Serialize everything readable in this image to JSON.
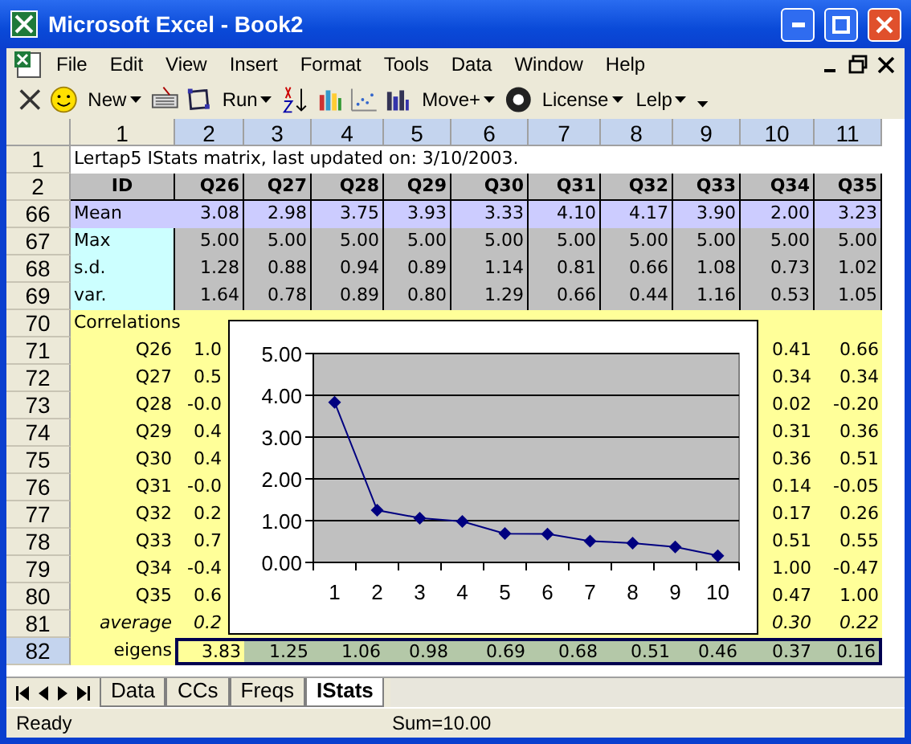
{
  "window": {
    "title": "Microsoft Excel - Book2"
  },
  "menu": [
    "File",
    "Edit",
    "View",
    "Insert",
    "Format",
    "Tools",
    "Data",
    "Window",
    "Help"
  ],
  "toolbar": [
    {
      "kind": "icon"
    },
    {
      "kind": "icon"
    },
    {
      "kind": "dropdown",
      "label": "New"
    },
    {
      "kind": "icon"
    },
    {
      "kind": "icon"
    },
    {
      "kind": "dropdown",
      "label": "Run"
    },
    {
      "kind": "icon"
    },
    {
      "kind": "icon"
    },
    {
      "kind": "icon"
    },
    {
      "kind": "icon"
    },
    {
      "kind": "dropdown",
      "label": "Move+"
    },
    {
      "kind": "icon"
    },
    {
      "kind": "dropdown",
      "label": "License"
    },
    {
      "kind": "dropdown",
      "label": "Lelp"
    },
    {
      "kind": "overflow"
    }
  ],
  "columns": [
    {
      "label": "1",
      "selected": false
    },
    {
      "label": "2",
      "selected": true
    },
    {
      "label": "3",
      "selected": true
    },
    {
      "label": "4",
      "selected": true
    },
    {
      "label": "5",
      "selected": true
    },
    {
      "label": "6",
      "selected": true
    },
    {
      "label": "7",
      "selected": true
    },
    {
      "label": "8",
      "selected": true
    },
    {
      "label": "9",
      "selected": true
    },
    {
      "label": "10",
      "selected": true
    },
    {
      "label": "11",
      "selected": true
    }
  ],
  "rows": [
    {
      "header": "1",
      "kind": "title",
      "selected": false,
      "cells": [
        "Lertap5 IStats matrix, last updated on: 3/10/2003."
      ]
    },
    {
      "header": "2",
      "kind": "heading",
      "selected": false,
      "cells": [
        "ID",
        "Q26",
        "Q27",
        "Q28",
        "Q29",
        "Q30",
        "Q31",
        "Q32",
        "Q33",
        "Q34",
        "Q35"
      ]
    },
    {
      "header": "66",
      "kind": "mean",
      "selected": false,
      "cells": [
        "Mean",
        "3.08",
        "2.98",
        "3.75",
        "3.93",
        "3.33",
        "4.10",
        "4.17",
        "3.90",
        "2.00",
        "3.23"
      ]
    },
    {
      "header": "67",
      "kind": "stat",
      "selected": false,
      "cells": [
        "Max",
        "5.00",
        "5.00",
        "5.00",
        "5.00",
        "5.00",
        "5.00",
        "5.00",
        "5.00",
        "5.00",
        "5.00"
      ]
    },
    {
      "header": "68",
      "kind": "stat",
      "selected": false,
      "cells": [
        "s.d.",
        "1.28",
        "0.88",
        "0.94",
        "0.89",
        "1.14",
        "0.81",
        "0.66",
        "1.08",
        "0.73",
        "1.02"
      ]
    },
    {
      "header": "69",
      "kind": "stat",
      "selected": false,
      "cells": [
        "var.",
        "1.64",
        "0.78",
        "0.89",
        "0.80",
        "1.29",
        "0.66",
        "0.44",
        "1.16",
        "0.53",
        "1.05"
      ]
    },
    {
      "header": "70",
      "kind": "section",
      "selected": false,
      "cells": [
        "Correlations"
      ]
    },
    {
      "header": "71",
      "kind": "corr",
      "selected": false,
      "cells": [
        "Q26",
        "1.0",
        null,
        null,
        null,
        null,
        null,
        null,
        null,
        "0.41",
        "0.66"
      ]
    },
    {
      "header": "72",
      "kind": "corr",
      "selected": false,
      "cells": [
        "Q27",
        "0.5",
        null,
        null,
        null,
        null,
        null,
        null,
        null,
        "0.34",
        "0.34"
      ]
    },
    {
      "header": "73",
      "kind": "corr",
      "selected": false,
      "cells": [
        "Q28",
        "-0.0",
        null,
        null,
        null,
        null,
        null,
        null,
        null,
        "0.02",
        "-0.20"
      ]
    },
    {
      "header": "74",
      "kind": "corr",
      "selected": false,
      "cells": [
        "Q29",
        "0.4",
        null,
        null,
        null,
        null,
        null,
        null,
        null,
        "0.31",
        "0.36"
      ]
    },
    {
      "header": "75",
      "kind": "corr",
      "selected": false,
      "cells": [
        "Q30",
        "0.4",
        null,
        null,
        null,
        null,
        null,
        null,
        null,
        "0.36",
        "0.51"
      ]
    },
    {
      "header": "76",
      "kind": "corr",
      "selected": false,
      "cells": [
        "Q31",
        "-0.0",
        null,
        null,
        null,
        null,
        null,
        null,
        null,
        "0.14",
        "-0.05"
      ]
    },
    {
      "header": "77",
      "kind": "corr",
      "selected": false,
      "cells": [
        "Q32",
        "0.2",
        null,
        null,
        null,
        null,
        null,
        null,
        null,
        "0.17",
        "0.26"
      ]
    },
    {
      "header": "78",
      "kind": "corr",
      "selected": false,
      "cells": [
        "Q33",
        "0.7",
        null,
        null,
        null,
        null,
        null,
        null,
        null,
        "0.51",
        "0.55"
      ]
    },
    {
      "header": "79",
      "kind": "corr",
      "selected": false,
      "cells": [
        "Q34",
        "-0.4",
        null,
        null,
        null,
        null,
        null,
        null,
        null,
        "1.00",
        "-0.47"
      ]
    },
    {
      "header": "80",
      "kind": "corr",
      "selected": false,
      "cells": [
        "Q35",
        "0.6",
        null,
        null,
        null,
        null,
        null,
        null,
        null,
        "0.47",
        "1.00"
      ]
    },
    {
      "header": "81",
      "kind": "average",
      "selected": false,
      "cells": [
        "average",
        "0.2",
        null,
        null,
        null,
        null,
        null,
        null,
        null,
        "0.30",
        "0.22"
      ]
    },
    {
      "header": "82",
      "kind": "eigens",
      "selected": true,
      "cells": [
        "eigens",
        "3.83",
        "1.25",
        "1.06",
        "0.98",
        "0.69",
        "0.68",
        "0.51",
        "0.46",
        "0.37",
        "0.16"
      ]
    }
  ],
  "chart_data": {
    "type": "line",
    "grid": true,
    "categories": [
      "1",
      "2",
      "3",
      "4",
      "5",
      "6",
      "7",
      "8",
      "9",
      "10"
    ],
    "series": [
      {
        "color": "#000080",
        "marker": "diamond",
        "values": [
          3.83,
          1.25,
          1.06,
          0.98,
          0.69,
          0.68,
          0.51,
          0.46,
          0.37,
          0.16
        ]
      }
    ],
    "ylim": [
      0,
      5
    ],
    "yticks": [
      {
        "value": 0,
        "label": "0.00"
      },
      {
        "value": 1,
        "label": "1.00"
      },
      {
        "value": 2,
        "label": "2.00"
      },
      {
        "value": 3,
        "label": "3.00"
      },
      {
        "value": 4,
        "label": "4.00"
      },
      {
        "value": 5,
        "label": "5.00"
      }
    ]
  },
  "sheet_tabs": [
    {
      "label": "Data",
      "selected": false
    },
    {
      "label": "CCs",
      "selected": false
    },
    {
      "label": "Freqs",
      "selected": false
    },
    {
      "label": "IStats",
      "selected": true
    }
  ],
  "status_bar": {
    "state": "Ready",
    "sum": "Sum=10.00"
  }
}
